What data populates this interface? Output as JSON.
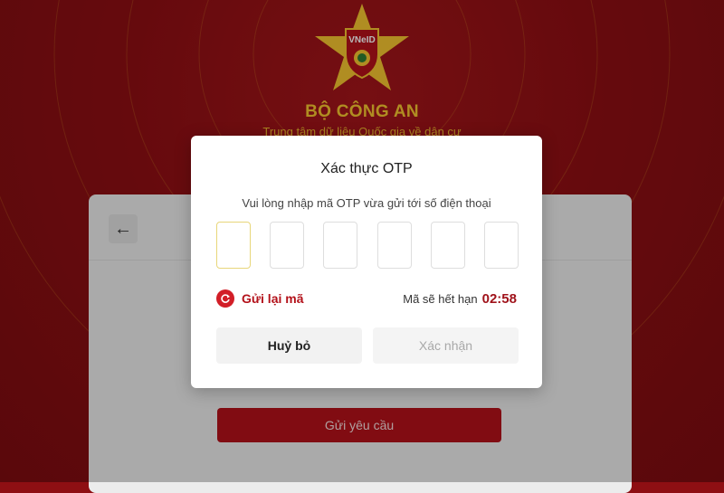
{
  "header": {
    "logo_text": "VNeID",
    "org_title": "BỘ CÔNG AN",
    "org_subtitle": "Trung tâm dữ liệu Quốc gia về dân cư"
  },
  "form": {
    "back_icon": "arrow-left-icon",
    "submit_label": "Gửi yêu cầu"
  },
  "modal": {
    "title": "Xác thực OTP",
    "description": "Vui lòng nhập mã OTP vừa gửi tới số điện thoại",
    "otp_digits": [
      "",
      "",
      "",
      "",
      "",
      ""
    ],
    "resend_label": "Gửi lại mã",
    "expire_label": "Mã sẽ hết hạn",
    "expire_time": "02:58",
    "cancel_label": "Huỷ bỏ",
    "confirm_label": "Xác nhận"
  },
  "colors": {
    "brand_red": "#8e0f13",
    "accent_red": "#b3111a",
    "gold": "#f4c430"
  }
}
